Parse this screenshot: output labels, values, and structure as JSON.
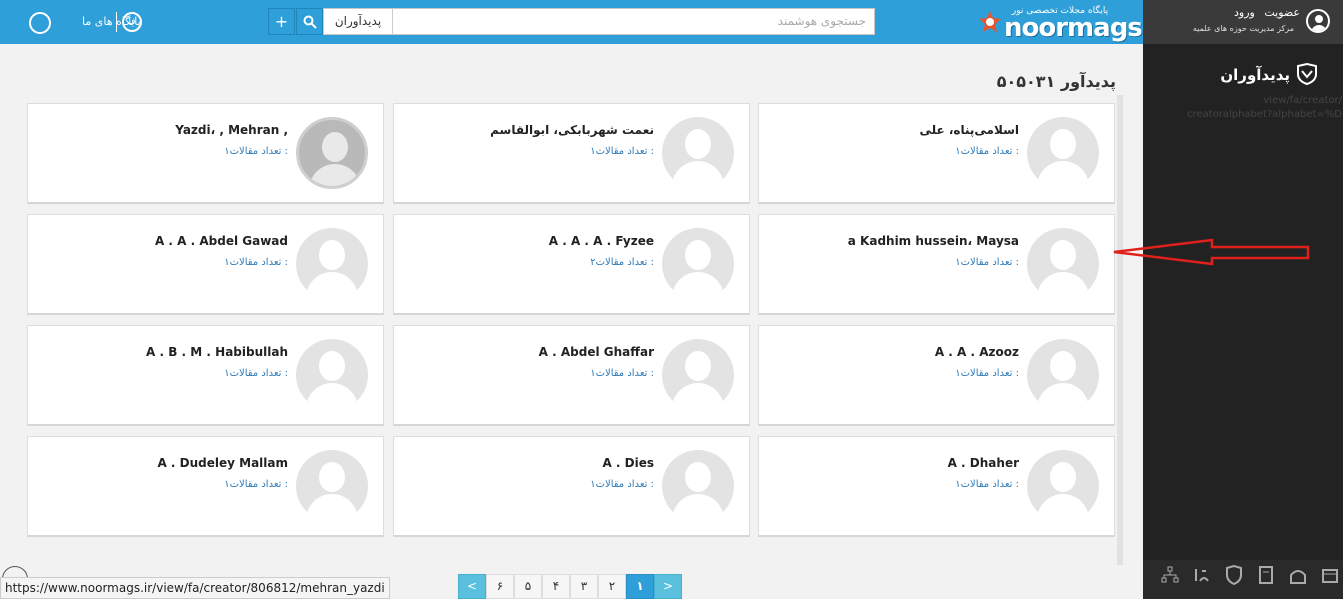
{
  "header": {
    "brand_sub": "پایگاه مجلات تخصصی نور",
    "brand_name": "noormags",
    "search_placeholder": "جستجوی هوشمند",
    "search_filter": "پدیدآوران",
    "plus_label": "+",
    "lang_label": "فا",
    "our_bases": "پایگاه های ما"
  },
  "sidebar": {
    "login": "ورود",
    "register": "عضویت",
    "subtitle": "مرکز مدیریت حوزه های علمیه",
    "title": "پدیدآوران",
    "url_line1": "view/fa/creator/",
    "url_line2": "creatoralphabet?alphabet=%D"
  },
  "main": {
    "heading": "۵۰۵۰۳۱ پدیدآور",
    "count_label": "تعداد مقالات :",
    "creators": [
      {
        "name": "اسلامی‌پناه، علی",
        "count": "۱"
      },
      {
        "name": "نعمت شهربابکی، ابوالقاسم",
        "count": "۱"
      },
      {
        "name": "Yazdi، , Mehran ,",
        "count": "۱"
      },
      {
        "name": "a Kadhim hussein، Maysa",
        "count": "۱"
      },
      {
        "name": "A . A . A . Fyzee",
        "count": "۲"
      },
      {
        "name": "A . A . Abdel Gawad",
        "count": "۱"
      },
      {
        "name": "A . A . Azooz",
        "count": "۱"
      },
      {
        "name": "A . Abdel Ghaffar",
        "count": "۱"
      },
      {
        "name": "A . B . M . Habibullah",
        "count": "۱"
      },
      {
        "name": "A . Dhaher",
        "count": "۱"
      },
      {
        "name": "A . Dies",
        "count": "۱"
      },
      {
        "name": "A . Dudeley Mallam",
        "count": "۱"
      }
    ]
  },
  "pagination": {
    "prev": "<",
    "next": ">",
    "pages": [
      "۶",
      "۵",
      "۴",
      "۳",
      "۲",
      "۱"
    ]
  },
  "status_bar": {
    "url": "https://www.noormags.ir/view/fa/creator/806812/mehran_yazdi"
  },
  "colors": {
    "header_blue": "#2e9fd8",
    "sidebar_dark": "#222222",
    "link_blue": "#2e7ab8",
    "annotation_red": "#e0201a"
  }
}
